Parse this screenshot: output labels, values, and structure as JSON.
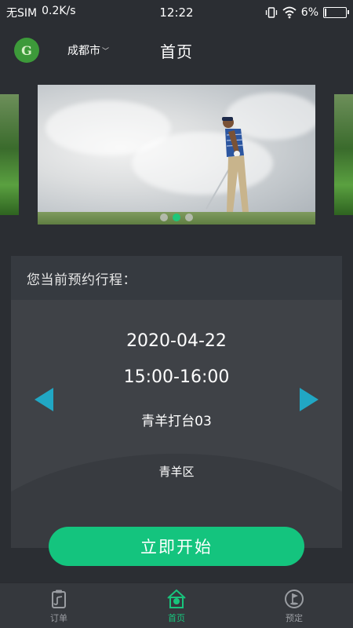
{
  "status_bar": {
    "carrier": "无SIM",
    "speed": "0.2K/s",
    "time": "12:22",
    "battery": "6%",
    "battery_level": 0.06
  },
  "header": {
    "logo_text": "G",
    "city": "成都市",
    "title": "首页"
  },
  "banner": {
    "slides_count": 3,
    "active_index": 1
  },
  "booking": {
    "heading": "您当前预约行程：",
    "date": "2020-04-22",
    "time": "15:00-16:00",
    "bay": "青羊打台03",
    "area": "青羊区"
  },
  "start_button": {
    "label": "立即开始"
  },
  "bottom_nav": {
    "items": [
      {
        "label": "订单",
        "icon": "clipboard-icon",
        "active": false
      },
      {
        "label": "首页",
        "icon": "home-icon",
        "active": true
      },
      {
        "label": "预定",
        "icon": "golf-flag-icon",
        "active": false
      }
    ]
  },
  "colors": {
    "background": "#2b2e33",
    "accent_green": "#14c47e",
    "arrow_blue": "#21a7c4",
    "card": "#3b3e44"
  }
}
